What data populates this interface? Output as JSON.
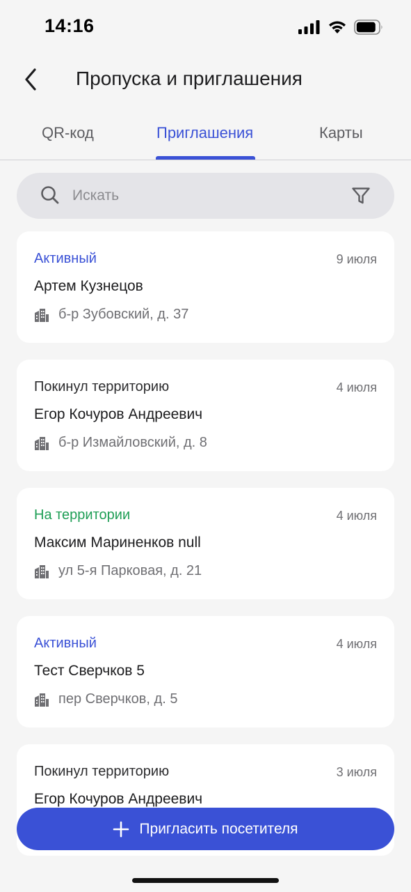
{
  "status_bar": {
    "time": "14:16"
  },
  "header": {
    "title": "Пропуска и приглашения"
  },
  "tabs": [
    {
      "label": "QR-код",
      "active": false
    },
    {
      "label": "Приглашения",
      "active": true
    },
    {
      "label": "Карты",
      "active": false
    }
  ],
  "search": {
    "placeholder": "Искать",
    "value": ""
  },
  "colors": {
    "accent": "#3a51d6",
    "status_active": "#3a51d6",
    "status_on_territory": "#1e9e55",
    "status_left": "#2c2c2e"
  },
  "invitations": [
    {
      "status": "Активный",
      "status_type": "active",
      "date": "9 июля",
      "name": "Артем Кузнецов",
      "address": "б-р Зубовский, д. 37"
    },
    {
      "status": "Покинул территорию",
      "status_type": "left",
      "date": "4 июля",
      "name": "Егор Кочуров Андреевич",
      "address": "б-р Измайловский, д. 8"
    },
    {
      "status": "На территории",
      "status_type": "on_territory",
      "date": "4 июля",
      "name": "Максим Мариненков null",
      "address": "ул 5-я Парковая, д. 21"
    },
    {
      "status": "Активный",
      "status_type": "active",
      "date": "4 июля",
      "name": "Тест Сверчков 5",
      "address": "пер Сверчков, д. 5"
    },
    {
      "status": "Покинул территорию",
      "status_type": "left",
      "date": "3 июля",
      "name": "Егор Кочуров Андреевич",
      "address": ""
    }
  ],
  "invite_button": {
    "label": "Пригласить посетителя",
    "icon": "plus-icon"
  }
}
